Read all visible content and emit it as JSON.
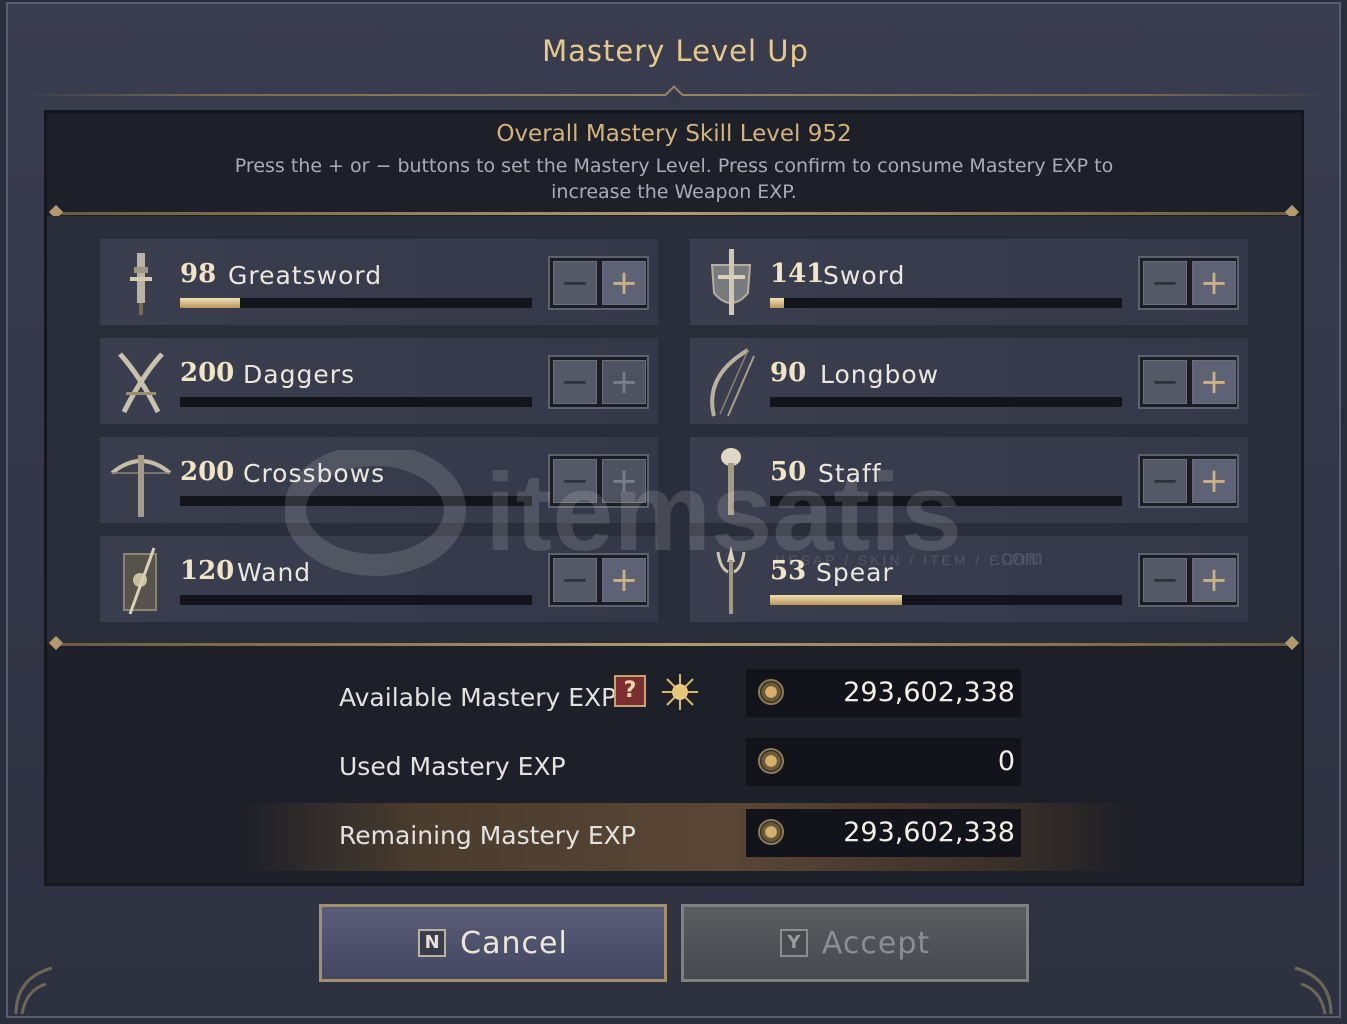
{
  "dialog": {
    "title": "Mastery Level Up"
  },
  "overall": {
    "label": "Overall Mastery Skill Level 952",
    "hint": "Press the + or − buttons to set the Mastery Level. Press confirm to consume Mastery EXP to increase the Weapon EXP."
  },
  "weapons": [
    {
      "level": "98",
      "name": "Greatsword",
      "progress": 0.17,
      "icon": "greatsword-icon",
      "plus_enabled": true
    },
    {
      "level": "141",
      "name": "Sword",
      "progress": 0.04,
      "icon": "sword-shield-icon",
      "plus_enabled": true
    },
    {
      "level": "200",
      "name": "Daggers",
      "progress": 0.0,
      "icon": "daggers-icon",
      "plus_enabled": false
    },
    {
      "level": "90",
      "name": "Longbow",
      "progress": 0.0,
      "icon": "longbow-icon",
      "plus_enabled": true
    },
    {
      "level": "200",
      "name": "Crossbows",
      "progress": 0.0,
      "icon": "crossbow-icon",
      "plus_enabled": false
    },
    {
      "level": "50",
      "name": "Staff",
      "progress": 0.0,
      "icon": "staff-icon",
      "plus_enabled": true
    },
    {
      "level": "120",
      "name": "Wand",
      "progress": 0.0,
      "icon": "wand-icon",
      "plus_enabled": true
    },
    {
      "level": "53",
      "name": "Spear",
      "progress": 0.375,
      "icon": "spear-icon",
      "plus_enabled": true
    }
  ],
  "stepper": {
    "minus": "−",
    "plus": "+"
  },
  "stats": {
    "available_label": "Available Mastery EXP",
    "available_value": "293,602,338",
    "help_glyph": "?",
    "used_label": "Used Mastery EXP",
    "used_value": "0",
    "remaining_label": "Remaining Mastery EXP",
    "remaining_value": "293,602,338"
  },
  "buttons": {
    "cancel_key": "N",
    "cancel_label": "Cancel",
    "accept_key": "Y",
    "accept_label": "Accept"
  },
  "watermark": {
    "text": "itemsatis",
    "subtext": "HESAP / SKIN / ITEM / E-PIN",
    "suffix": ".com"
  },
  "colors": {
    "accent_gold": "#e7c98b",
    "progress_fill": "#d9bd86",
    "help_red": "#7a2e30"
  }
}
